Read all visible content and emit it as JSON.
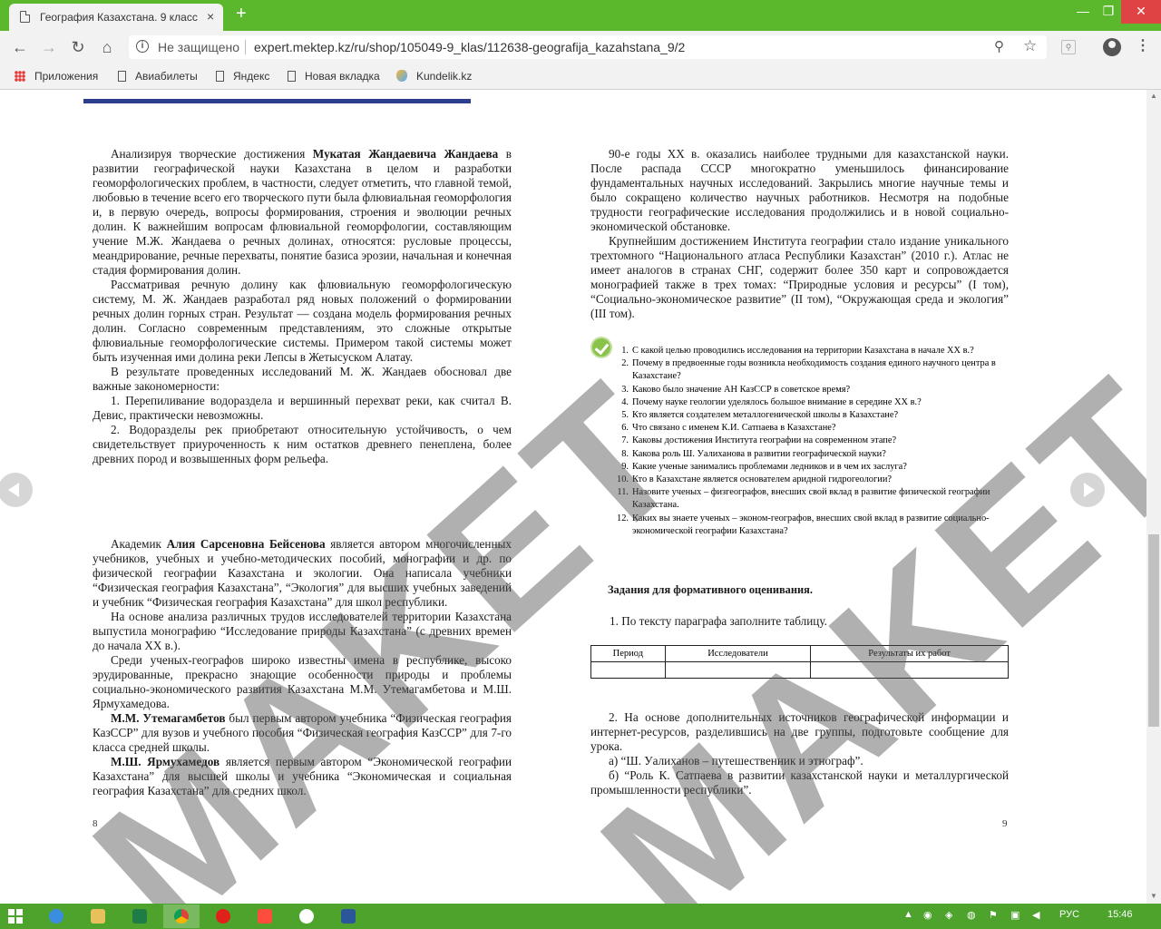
{
  "browser": {
    "tab_title": "География Казахстана. 9 класс -",
    "tab_close": "×",
    "new_tab": "+",
    "window_buttons": {
      "minimize": "—",
      "maximize": "❐",
      "close": "✕"
    },
    "nav": {
      "back": "←",
      "forward": "→",
      "reload": "↻",
      "home": "⌂"
    },
    "security_label": "Не защищено",
    "url": "expert.mektep.kz/ru/shop/105049-9_klas/112638-geografija_kazahstana_9/2",
    "menu": "⋮",
    "bookmarks": [
      "Приложения",
      "Авиабилеты",
      "Яндекс",
      "Новая вкладка",
      "Kundelik.kz"
    ]
  },
  "document": {
    "watermark": "MAKET",
    "left_page": {
      "paragraphs": [
        [
          "Анализируя творческие достижения ",
          "Мукатая Жандаевича Жандаева",
          " в развитии географической науки Казахстана в целом и разработки геоморфологических проблем, в частности, следует отметить, что главной темой, любовью в течение всего его творческого пути была флювиальная геоморфология и, в первую очередь, вопросы формирования, строения и эволюции речных долин. К важнейшим вопросам флювиальной геоморфологии, составляющим учение М.Ж. Жандаева о речных долинах, относятся: русловые процессы, меандрирование, речные перехваты, понятие базиса эрозии, начальная и конечная стадия формирования долин."
        ],
        [
          "Рассматривая речную долину как флювиальную геоморфологическую систему, М. Ж. Жандаев разработал ряд новых положений о формировании речных долин горных стран. Результат — создана модель формирования речных долин. Согласно современным представлениям, это сложные открытые флювиальные геоморфологические системы. Примером такой системы может быть изученная ими долина реки Лепсы в Жетысуском Алатау."
        ],
        [
          "В результате проведенных исследований М. Ж. Жандаев обосновал две важные закономерности:"
        ],
        [
          "1. Перепиливание водораздела и вершинный перехват реки, как считал В. Девис, практически невозможны."
        ],
        [
          "2. Водоразделы рек приобретают относительную устойчивость, о чем свидетельствует приуроченность к ним остатков древнего пенеплена, более древних пород и возвышенных форм рельефа."
        ]
      ],
      "paragraphs2": [
        [
          "Академик ",
          "Алия Сарсеновна Бейсенова",
          " является автором многочисленных учебников, учебных и учебно-методических пособий, монографии и др. по физической географии Казахстана и экологии. Она написала учебники “Физическая география Казахстана”, “Экология” для высших учебных заведений и учебник “Физическая география Казахстана” для школ республики."
        ],
        [
          "На основе анализа различных трудов исследователей территории Казахстана выпустила монографию “Исследование природы Казахстана” (с древних времен до начала ХХ в.)."
        ],
        [
          "Среди ученых-географов широко известны имена в республике, высоко эрудированные, прекрасно знающие особенности природы и проблемы социально-экономического развития Казахстана М.М. Утемагамбетова и М.Ш. Ярмухамедова."
        ],
        [
          "",
          "М.М. Утемагамбетов",
          " был первым автором учебника “Физическая география КазССР” для вузов и учебного пособия “Физическая география КазССР” для 7-го класса средней школы."
        ],
        [
          "",
          "М.Ш. Ярмухамедов",
          " является первым автором “Экономической географии Казахстана” для высшей школы и учебника “Экономическая и социальная география Казахстана” для средних школ."
        ]
      ],
      "page_number": "8"
    },
    "right_page": {
      "paragraphs": [
        "90-е годы ХХ в. оказались наиболее трудными для казахстанской науки. После распада СССР многократно уменьшилось финансирование фундаментальных научных исследований. Закрылись многие научные темы и было сокращено количество научных работников. Несмотря на подобные трудности географические исследования продолжились и в новой социально-экономической обстановке.",
        "Крупнейшим достижением Института географии стало издание уникального трехтомного “Национального атласа Республики Казахстан” (2010 г.). Атлас не имеет аналогов в странах СНГ, содержит более 350 карт и сопровождается монографией также в трех томах: “Природные условия и ресурсы” (I том), “Социально-экономическое развитие” (II том), “Окружающая среда и экология” (III том)."
      ],
      "questions": [
        {
          "n": "1.",
          "t": "С какой целью проводились исследования на территории Казахстана в начале ХХ в.?"
        },
        {
          "n": "2.",
          "t": "Почему в предвоенные годы возникла необходимость создания единого научного центра в Казахстане?"
        },
        {
          "n": "3.",
          "t": "Каково было значение АН КазССР в советское время?"
        },
        {
          "n": "4.",
          "t": "Почему науке геологии уделялось большое внимание в середине ХХ в.?"
        },
        {
          "n": "5.",
          "t": "Кто является создателем металлогенической школы в Казахстане?"
        },
        {
          "n": "6.",
          "t": "Что связано с именем К.И. Сатпаева в Казахстане?"
        },
        {
          "n": "7.",
          "t": "Каковы достижения Института географии на современном этапе?"
        },
        {
          "n": "8.",
          "t": "Какова роль Ш. Уалиханова в развитии географической науки?"
        },
        {
          "n": "9.",
          "t": "Какие ученые занимались проблемами ледников и в чем их заслуга?"
        },
        {
          "n": "10.",
          "t": "Кто в Казахстане является основателем аридной гидрогеологии?"
        },
        {
          "n": "11.",
          "t": "Назовите ученых – физгеографов, внесших свой вклад в развитие физической географии Казахстана."
        },
        {
          "n": "12.",
          "t": "Каких вы знаете ученых – эконом-географов, внесших свой вклад в развитие социально-экономической географии Казахстана?"
        }
      ],
      "tasks_heading": "Задания для формативного оценивания.",
      "task1": "1. По тексту параграфа заполните таблицу.",
      "table_headers": [
        "Период",
        "Исследователи",
        "Результаты их работ"
      ],
      "task2": "2. На основе дополнительных источников географической информации и интернет-ресурсов, разделившись на две группы, подготовьте сообщение для урока.",
      "task2a": "а) “Ш. Уалиханов – путешественник и этнограф”.",
      "task2b": "б) “Роль К. Сатпаева в развитии казахстанской науки и металлургической промышленности республики”.",
      "page_number": "9"
    }
  },
  "taskbar": {
    "language": "РУС",
    "time": "15:46"
  }
}
